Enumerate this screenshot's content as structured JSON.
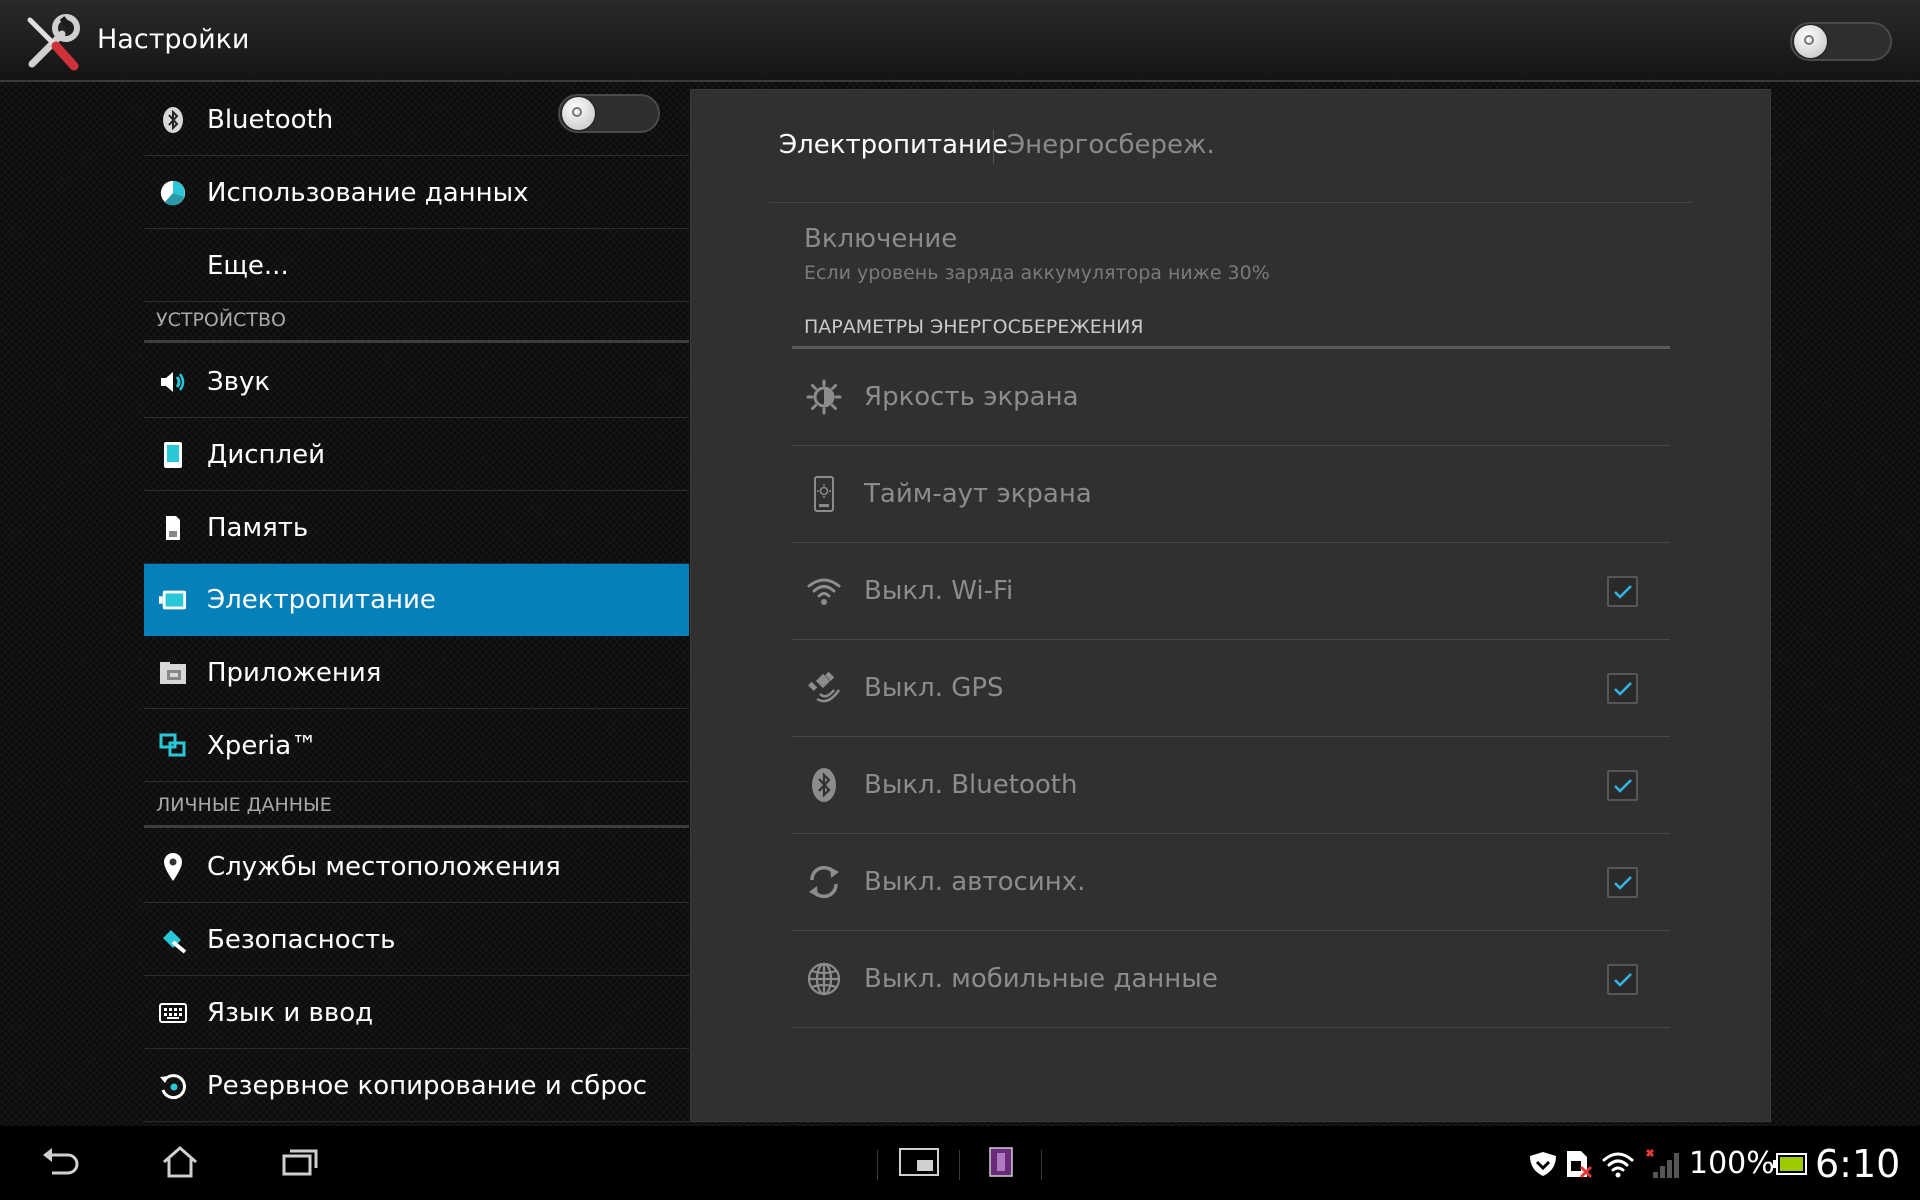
{
  "app": {
    "title": "Настройки",
    "master_toggle_on": false
  },
  "sidebar": {
    "bluetooth": {
      "label": "Bluetooth",
      "toggle_on": false
    },
    "items_top": [
      {
        "label": "Использование данных",
        "icon": "data-usage-icon"
      },
      {
        "label": "Еще...",
        "icon": ""
      }
    ],
    "device_header": "УСТРОЙСТВО",
    "device_items": [
      {
        "label": "Звук",
        "icon": "speaker-icon"
      },
      {
        "label": "Дисплей",
        "icon": "display-icon"
      },
      {
        "label": "Память",
        "icon": "storage-icon"
      },
      {
        "label": "Электропитание",
        "icon": "battery-icon",
        "selected": true
      },
      {
        "label": "Приложения",
        "icon": "apps-icon"
      },
      {
        "label": "Xperia™",
        "icon": "xperia-icon"
      }
    ],
    "personal_header": "ЛИЧНЫЕ ДАННЫЕ",
    "personal_items": [
      {
        "label": "Службы местоположения",
        "icon": "location-pin-icon"
      },
      {
        "label": "Безопасность",
        "icon": "security-icon"
      },
      {
        "label": "Язык и ввод",
        "icon": "keyboard-icon"
      },
      {
        "label": "Резервное копирование и сброс",
        "icon": "backup-icon"
      }
    ]
  },
  "panel": {
    "tabs": [
      {
        "label": "Электропитание",
        "active": true
      },
      {
        "label": "Энергосбереж.",
        "active": false
      }
    ],
    "activation": {
      "title": "Включение",
      "summary": "Если уровень заряда аккумулятора ниже 30%"
    },
    "section_header": "ПАРАМЕТРЫ ЭНЕРГОСБЕРЕЖЕНИЯ",
    "settings": [
      {
        "label": "Яркость экрана",
        "icon": "brightness-icon",
        "checkbox": null
      },
      {
        "label": "Тайм-аут экрана",
        "icon": "screen-timeout-icon",
        "checkbox": null
      },
      {
        "label": "Выкл. Wi-Fi",
        "icon": "wifi-icon",
        "checkbox": true
      },
      {
        "label": "Выкл. GPS",
        "icon": "gps-satellite-icon",
        "checkbox": true
      },
      {
        "label": "Выкл. Bluetooth",
        "icon": "bluetooth-icon",
        "checkbox": true
      },
      {
        "label": "Выкл. автосинх.",
        "icon": "sync-icon",
        "checkbox": true
      },
      {
        "label": "Выкл. мобильные данные",
        "icon": "globe-icon",
        "checkbox": true
      }
    ]
  },
  "status_bar": {
    "battery_percent": "100%",
    "time": "6:10",
    "battery_level": 1.0
  },
  "colors": {
    "accent": "#0580b8",
    "check": "#33b5e5",
    "icon_cyan": "#29c8d8"
  }
}
